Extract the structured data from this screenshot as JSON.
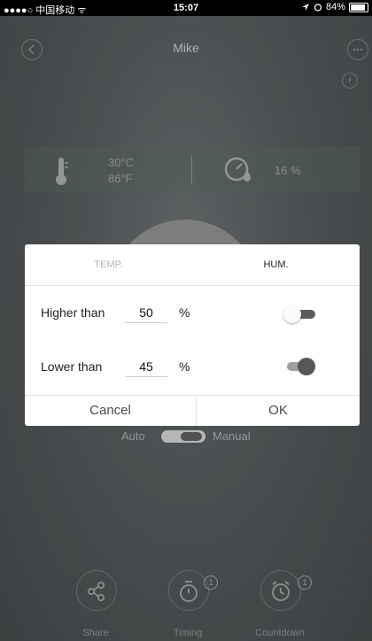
{
  "status_bar": {
    "carrier": "●●●●○ 中国移动 ᯤ",
    "time": "15:07",
    "battery": "84%",
    "battery_level": 0.84
  },
  "nav": {
    "title": "Mike"
  },
  "sensor": {
    "temp_c": "30°C",
    "temp_f": "86°F",
    "humidity": "16 %"
  },
  "mode": {
    "auto_label": "Auto",
    "manual_label": "Manual",
    "selected": "Manual"
  },
  "actions": [
    {
      "label": "Share",
      "icon": "share-icon"
    },
    {
      "label": "Timing",
      "icon": "stopwatch-icon",
      "badge": "1"
    },
    {
      "label": "Countdown",
      "icon": "alarm-clock-icon",
      "badge": "1"
    }
  ],
  "dialog": {
    "tabs": [
      {
        "label": "TEMP.",
        "active": false
      },
      {
        "label": "HUM.",
        "active": true
      }
    ],
    "rows": [
      {
        "label": "Higher than",
        "value": "50",
        "unit": "%",
        "enabled": false
      },
      {
        "label": "Lower than",
        "value": "45",
        "unit": "%",
        "enabled": true
      }
    ],
    "cancel_label": "Cancel",
    "ok_label": "OK"
  },
  "colors": {
    "background": "#55595b",
    "dialog": "#ffffff",
    "switch_on": "#555759"
  }
}
